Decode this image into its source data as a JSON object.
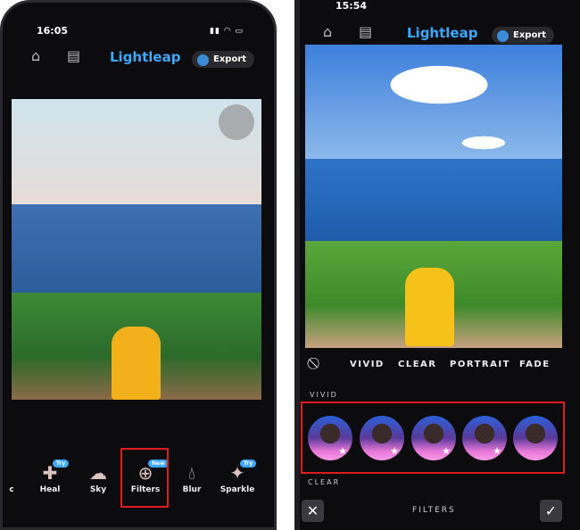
{
  "left": {
    "time": "16:05",
    "logo": "Lightleap",
    "export": "Export",
    "tools": [
      {
        "label": "c"
      },
      {
        "label": "Heal",
        "badge": "Try",
        "icon": "bandage-icon"
      },
      {
        "label": "Sky",
        "icon": "cloud-icon"
      },
      {
        "label": "Filters",
        "badge": "New",
        "icon": "filters-icon"
      },
      {
        "label": "Blur",
        "icon": "drop-icon"
      },
      {
        "label": "Sparkle",
        "badge": "Try",
        "icon": "sparkle-icon"
      }
    ]
  },
  "right": {
    "time": "15:54",
    "logo": "Lightleap",
    "export": "Export",
    "filter_tabs": [
      "VIVID",
      "CLEAR",
      "PORTRAIT",
      "FADE"
    ],
    "section_vivid": "VIVID",
    "section_clear": "CLEAR",
    "title": "FILTERS"
  },
  "colors": {
    "accent": "#3ea8ff",
    "highlight": "#e01b22"
  }
}
